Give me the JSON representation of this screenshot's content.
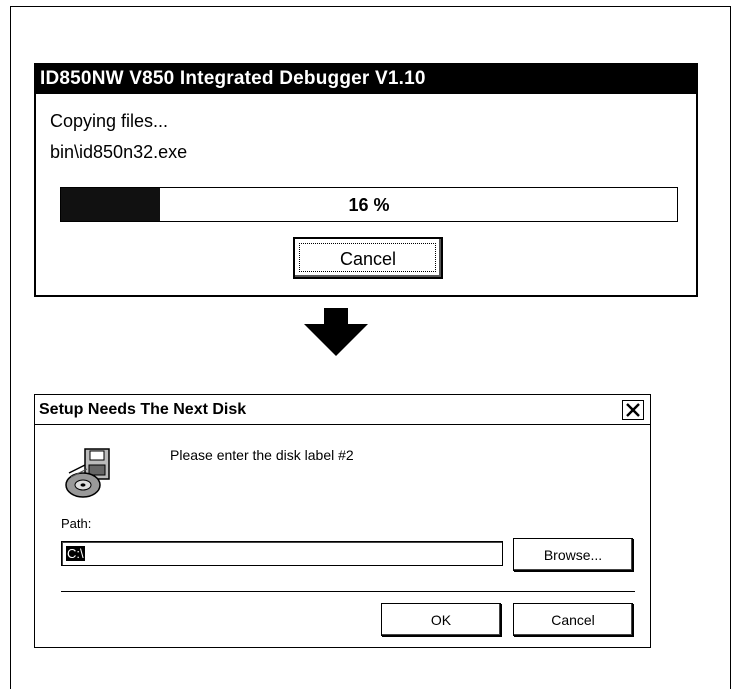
{
  "copy_dialog": {
    "title": "ID850NW V850 Integrated Debugger V1.10",
    "status": "Copying files...",
    "current_file": "bin\\id850n32.exe",
    "progress_text": "16 %",
    "progress_fraction": 0.16,
    "cancel_label": "Cancel"
  },
  "arrow_icon": "down-arrow",
  "disk_dialog": {
    "title": "Setup Needs The Next Disk",
    "close_icon": "close-icon",
    "disk_icon": "disk-drive-icon",
    "prompt": "Please enter the disk label #2",
    "path_label": "Path:",
    "path_value": "C:\\",
    "browse_label": "Browse...",
    "ok_label": "OK",
    "cancel_label": "Cancel"
  }
}
